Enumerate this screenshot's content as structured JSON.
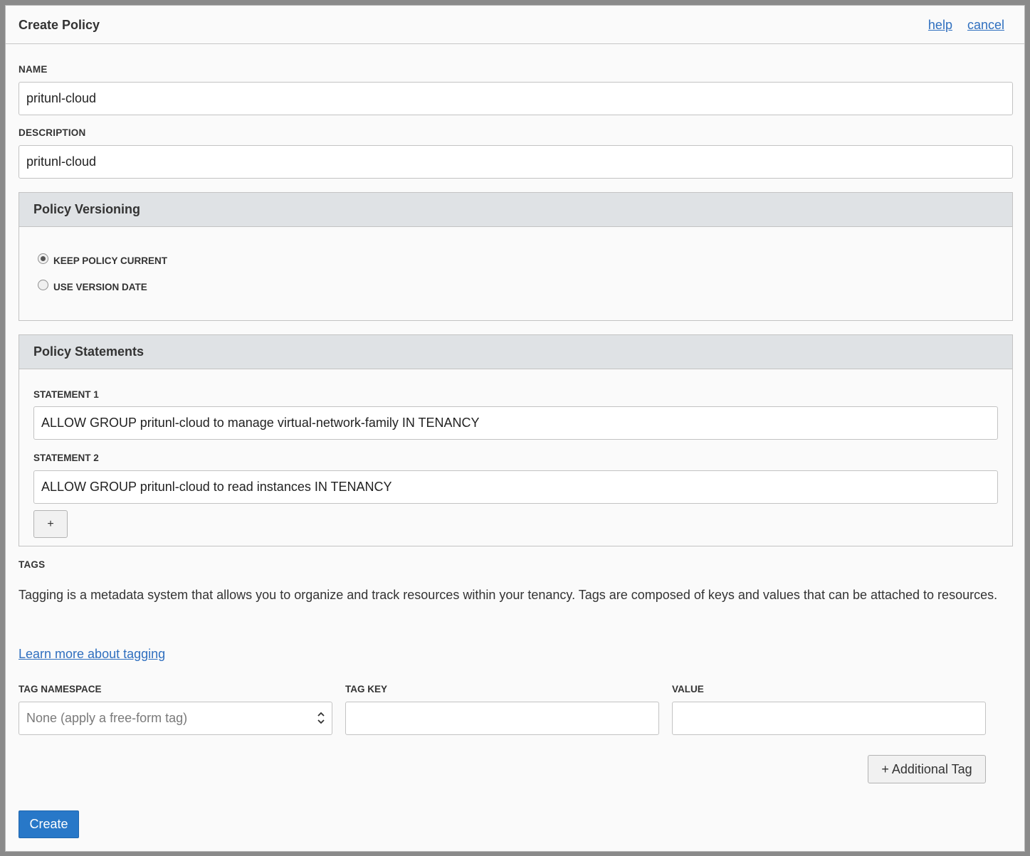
{
  "dialog": {
    "title": "Create Policy",
    "help_label": "help",
    "cancel_label": "cancel"
  },
  "name": {
    "label": "NAME",
    "value": "pritunl-cloud"
  },
  "description": {
    "label": "DESCRIPTION",
    "value": "pritunl-cloud"
  },
  "versioning": {
    "title": "Policy Versioning",
    "options": [
      {
        "label": "KEEP POLICY CURRENT",
        "checked": true
      },
      {
        "label": "USE VERSION DATE",
        "checked": false
      }
    ]
  },
  "statements": {
    "title": "Policy Statements",
    "items": [
      {
        "label": "STATEMENT 1",
        "value": "ALLOW GROUP pritunl-cloud to manage virtual-network-family IN TENANCY"
      },
      {
        "label": "STATEMENT 2",
        "value": "ALLOW GROUP pritunl-cloud to read instances IN TENANCY"
      }
    ],
    "add_label": "+"
  },
  "tags": {
    "label": "TAGS",
    "description": "Tagging is a metadata system that allows you to organize and track resources within your tenancy. Tags are composed of keys and values that can be attached to resources.",
    "learn_more": "Learn more about tagging",
    "namespace_label": "TAG NAMESPACE",
    "namespace_value": "None (apply a free-form tag)",
    "key_label": "TAG KEY",
    "key_value": "",
    "value_label": "VALUE",
    "value_value": "",
    "additional_label": "+ Additional Tag"
  },
  "actions": {
    "create_label": "Create"
  }
}
